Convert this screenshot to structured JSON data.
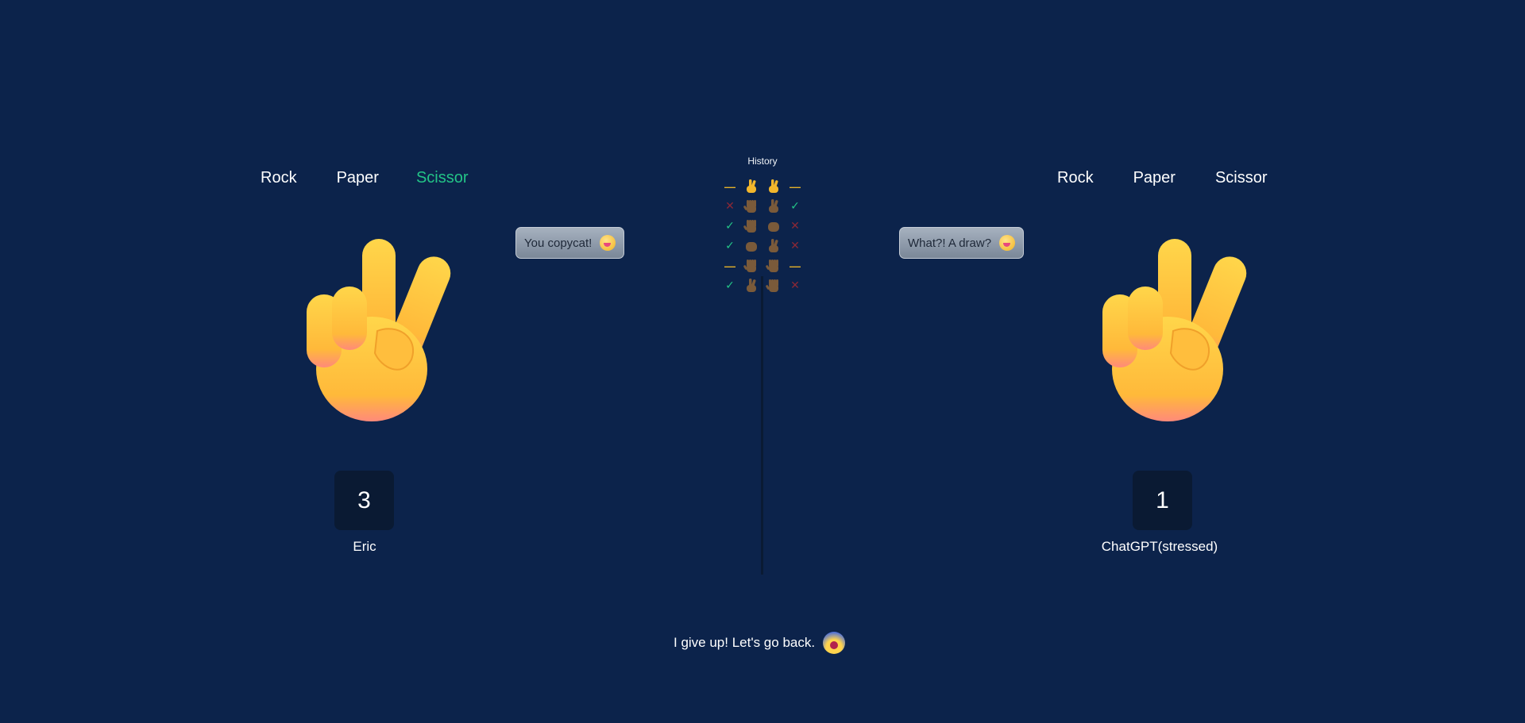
{
  "player": {
    "choices": [
      "Rock",
      "Paper",
      "Scissor"
    ],
    "active_choice_index": 2,
    "hand": "scissor-hand-icon",
    "bubble": "You copycat!",
    "bubble_icon": "zany-face-icon",
    "score": "3",
    "name": "Eric"
  },
  "opponent": {
    "choices": [
      "Rock",
      "Paper",
      "Scissor"
    ],
    "hand": "scissor-hand-icon",
    "bubble": "What?! A draw?",
    "bubble_icon": "zany-face-icon",
    "score": "1",
    "name": "ChatGPT(stressed)"
  },
  "history": {
    "title": "History",
    "rows": [
      {
        "left": "draw",
        "player": "scissor",
        "opponent": "scissor",
        "right": "draw"
      },
      {
        "left": "lose",
        "player": "paper",
        "opponent": "scissor",
        "right": "win"
      },
      {
        "left": "win",
        "player": "paper",
        "opponent": "rock",
        "right": "lose"
      },
      {
        "left": "win",
        "player": "rock",
        "opponent": "scissor",
        "right": "lose"
      },
      {
        "left": "draw",
        "player": "paper",
        "opponent": "paper",
        "right": "draw"
      },
      {
        "left": "win",
        "player": "scissor",
        "opponent": "paper",
        "right": "lose"
      }
    ]
  },
  "footer": {
    "give_up_label": "I give up! Let's go back.",
    "give_up_icon": "shocked-face-icon"
  },
  "colors": {
    "background": "#0c234b",
    "active": "#23c487",
    "win": "#23c487",
    "lose": "#8a2836",
    "draw": "#e3b12a"
  }
}
